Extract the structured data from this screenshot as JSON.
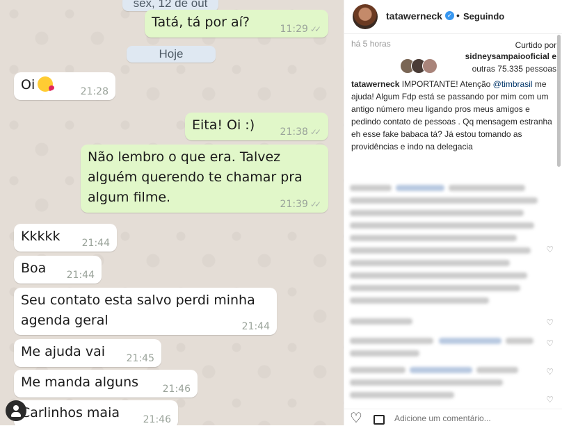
{
  "chat": {
    "date_top": "sex, 12 de out",
    "date_today": "Hoje",
    "messages": [
      {
        "text": "Tatá, tá por aí?",
        "time": "11:29",
        "dir": "out"
      },
      {
        "text": "Oi",
        "time": "21:28",
        "dir": "in",
        "emoji": "kissing-face-heart"
      },
      {
        "text": "Eita! Oi :)",
        "time": "21:38",
        "dir": "out"
      },
      {
        "text": "Não lembro o que era. Talvez\nalguém querendo te chamar pra\nalgum filme.",
        "time": "21:39",
        "dir": "out"
      },
      {
        "text": "Kkkkk",
        "time": "21:44",
        "dir": "in"
      },
      {
        "text": "Boa",
        "time": "21:44",
        "dir": "in"
      },
      {
        "text": "Seu contato esta salvo perdi minha\nagenda geral",
        "time": "21:44",
        "dir": "in"
      },
      {
        "text": "Me ajuda vai",
        "time": "21:45",
        "dir": "in"
      },
      {
        "text": "Me manda alguns",
        "time": "21:46",
        "dir": "in"
      },
      {
        "text": "Carlinhos maia",
        "time": "21:46",
        "dir": "in"
      }
    ],
    "read_ticks": "✓✓"
  },
  "post": {
    "username": "tatawerneck",
    "verified_icon": "verified-badge-icon",
    "separator": "•",
    "follow_status": "Seguindo",
    "age": "há 5 horas",
    "liked_prefix": "Curtido por",
    "liked_user": "sidneysampaiooficial e",
    "liked_others": "outras 75.335 pessoas",
    "caption_user": "tatawerneck",
    "caption_start": "IMPORTANTE! Atenção",
    "caption_mention": "@timbrasil",
    "caption_rest": "me ajuda! Algum Fdp está se passando por mim com um antigo número meu ligando pros meus amigos e pedindo contato de pessoas . Qq mensagem estranha eh esse fake babaca tá? Já estou tomando as providências e indo na delegacia",
    "comment_placeholder": "Adicione um comentário...",
    "heart_glyph": "♡",
    "like_glyph": "♡"
  }
}
